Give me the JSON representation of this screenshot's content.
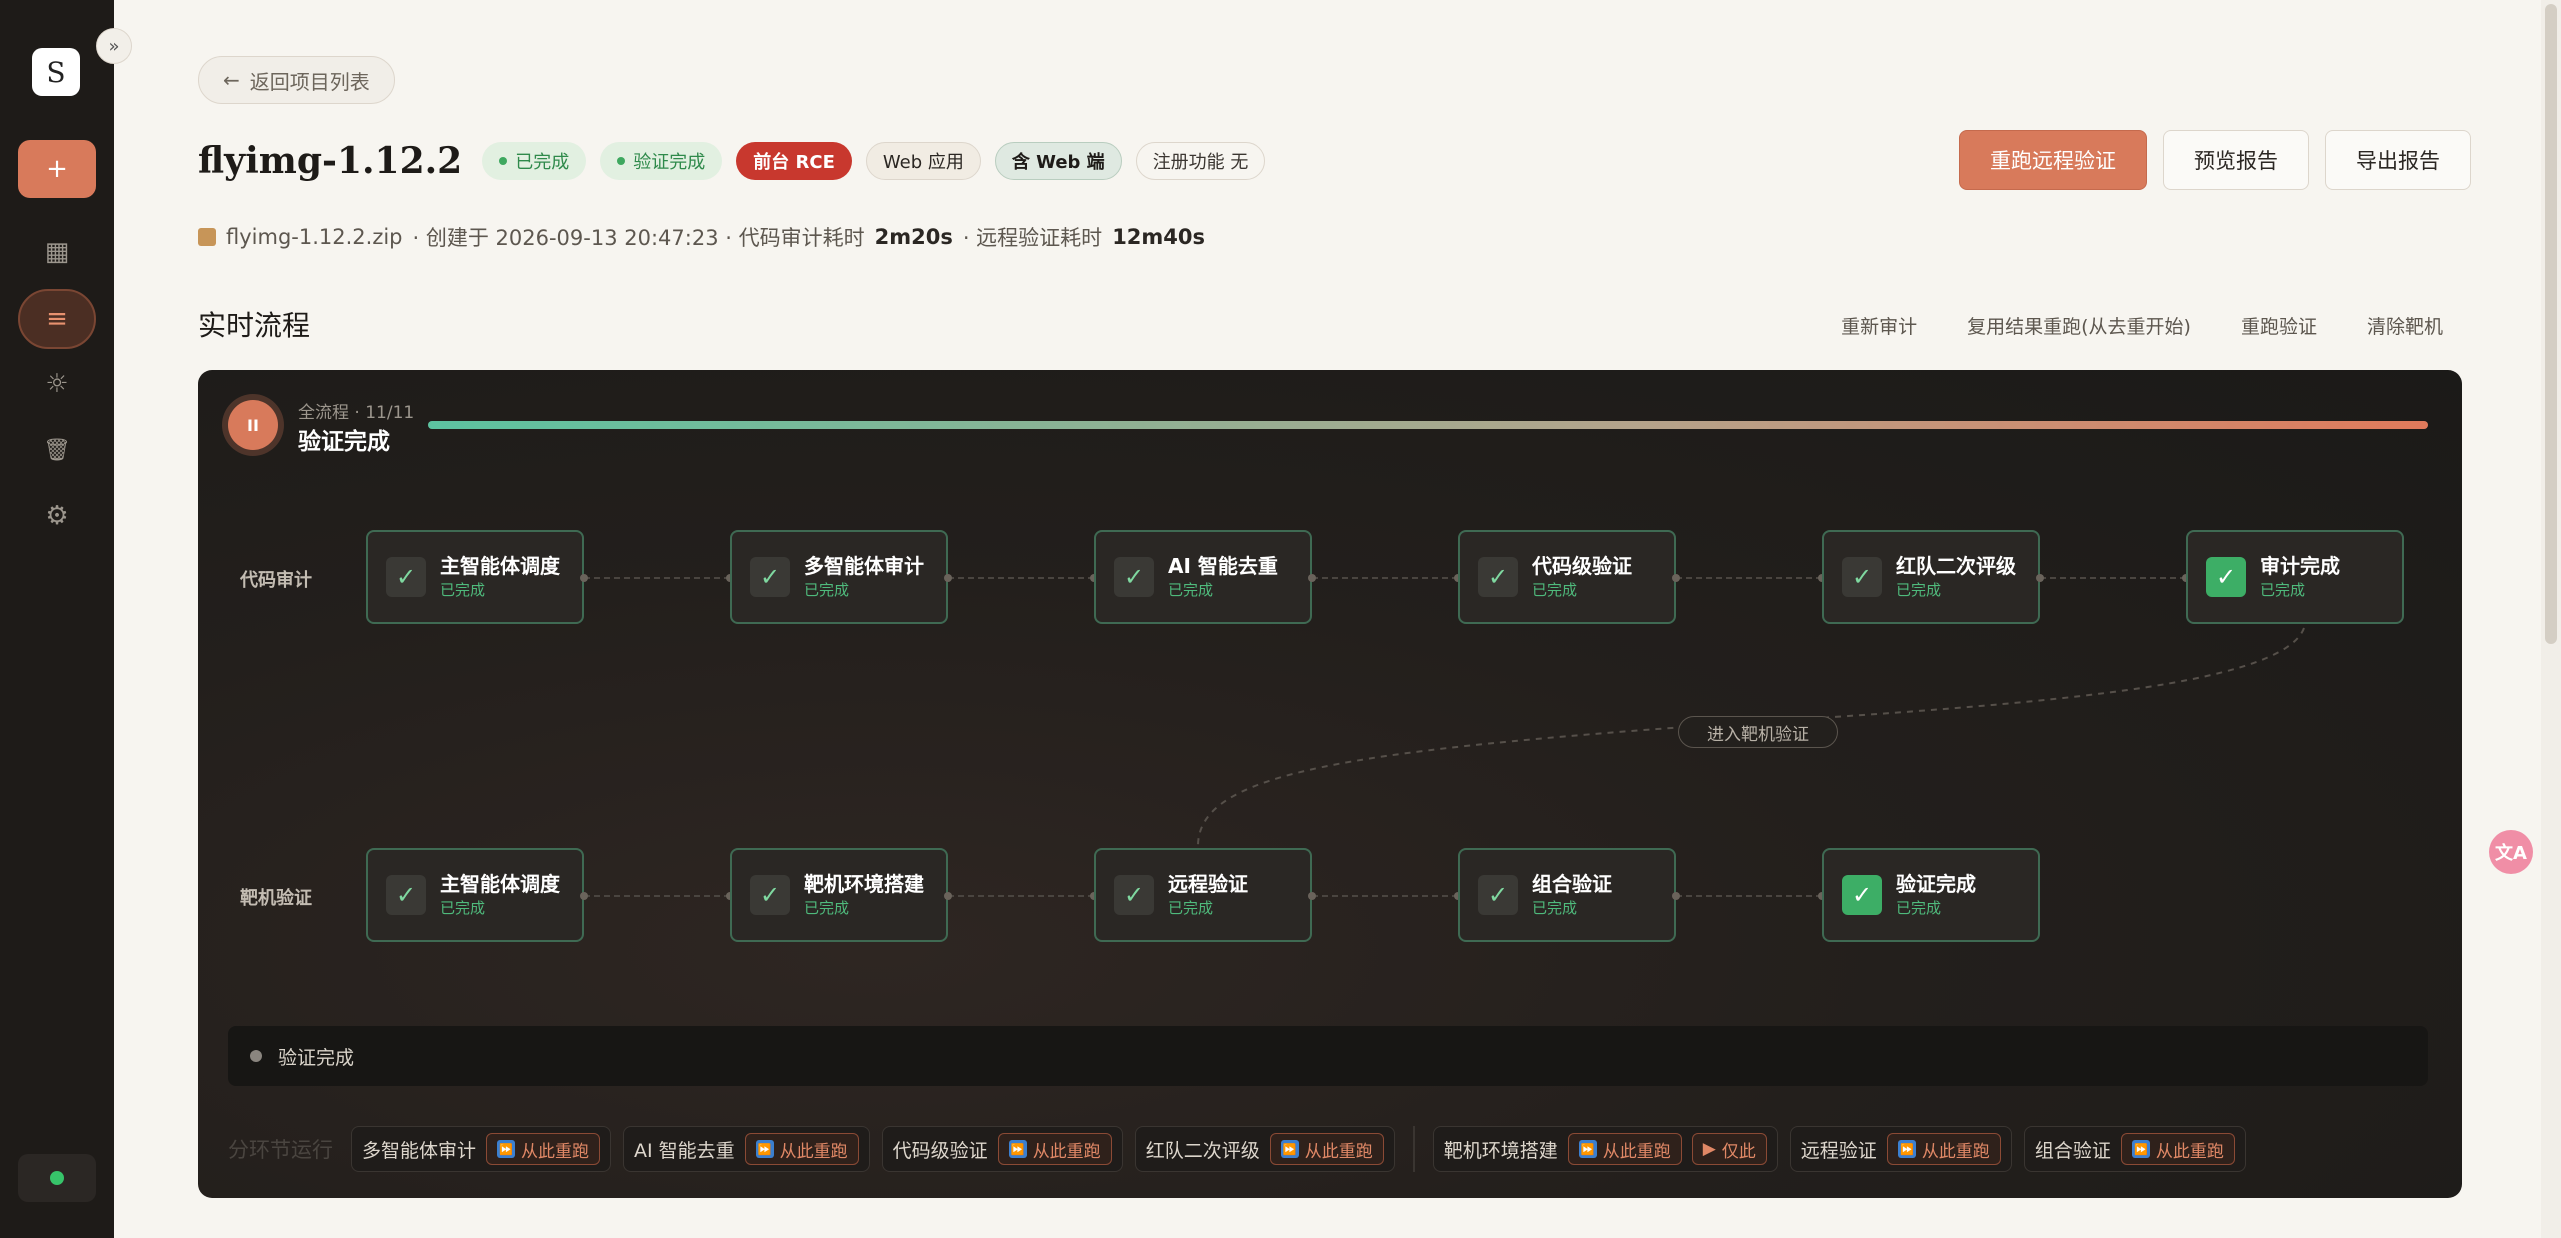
{
  "app": {
    "logo_glyph": "S"
  },
  "sidebar": {
    "collapse_glyph": "»",
    "new_glyph": "+",
    "items": [
      {
        "icon": "dashboard-icon",
        "glyph": "▦"
      },
      {
        "icon": "list-icon",
        "glyph": "≡"
      },
      {
        "icon": "sun-icon",
        "glyph": "☼"
      },
      {
        "icon": "trash-icon",
        "glyph": "🗑"
      },
      {
        "icon": "settings-icon",
        "glyph": "⚙"
      }
    ]
  },
  "header": {
    "back_label": "返回项目列表",
    "back_arrow": "←",
    "title": "flyimg-1.12.2",
    "badges": [
      {
        "label": "已完成",
        "style": "green"
      },
      {
        "label": "验证完成",
        "style": "green"
      },
      {
        "label": "前台 RCE",
        "style": "red"
      },
      {
        "label": "Web 应用",
        "style": "web"
      },
      {
        "label": "含 Web 端",
        "style": "webend"
      },
      {
        "label": "注册功能 无",
        "style": "reg"
      }
    ],
    "actions": {
      "rerun_remote": "重跑远程验证",
      "preview": "预览报告",
      "export": "导出报告"
    },
    "meta": {
      "file": "flyimg-1.12.2.zip",
      "created_prefix": "· 创建于 2026-09-13 20:47:23 · 代码审计耗时",
      "audit_time": "2m20s",
      "remote_prefix": "· 远程验证耗时",
      "remote_time": "12m40s"
    }
  },
  "section": {
    "title": "实时流程",
    "links": [
      "重新审计",
      "复用结果重跑(从去重开始)",
      "重跑验证",
      "清除靶机"
    ]
  },
  "flow": {
    "pause_glyph": "II",
    "label": "全流程 · 11/11",
    "status": "验证完成",
    "progress": 1.0,
    "lanes": [
      {
        "label": "代码审计",
        "nodes": [
          {
            "name": "主智能体调度",
            "status": "已完成",
            "final": false
          },
          {
            "name": "多智能体审计",
            "status": "已完成",
            "final": false
          },
          {
            "name": "AI 智能去重",
            "status": "已完成",
            "final": false
          },
          {
            "name": "代码级验证",
            "status": "已完成",
            "final": false
          },
          {
            "name": "红队二次评级",
            "status": "已完成",
            "final": false
          },
          {
            "name": "审计完成",
            "status": "已完成",
            "final": true
          }
        ]
      },
      {
        "label": "靶机验证",
        "nodes": [
          {
            "name": "主智能体调度",
            "status": "已完成",
            "final": false
          },
          {
            "name": "靶机环境搭建",
            "status": "已完成",
            "final": false
          },
          {
            "name": "远程验证",
            "status": "已完成",
            "final": false
          },
          {
            "name": "组合验证",
            "status": "已完成",
            "final": false
          },
          {
            "name": "验证完成",
            "status": "已完成",
            "final": true
          }
        ]
      }
    ],
    "transition_label": "进入靶机验证",
    "check_glyph": "✓",
    "log": "验证完成",
    "segment": {
      "title": "分环节运行",
      "rerun_label": "从此重跑",
      "only_label": "仅此",
      "items": [
        {
          "name": "多智能体审计",
          "only": false
        },
        {
          "name": "AI 智能去重",
          "only": false
        },
        {
          "name": "代码级验证",
          "only": false
        },
        {
          "name": "红队二次评级",
          "only": false
        },
        {
          "name": "靶机环境搭建",
          "only": true
        },
        {
          "name": "远程验证",
          "only": false
        },
        {
          "name": "组合验证",
          "only": false
        }
      ]
    }
  },
  "colors": {
    "accent": "#d87a5b",
    "success": "#3dae66",
    "danger": "#c8382e",
    "panel_bg": "#231f1c"
  }
}
